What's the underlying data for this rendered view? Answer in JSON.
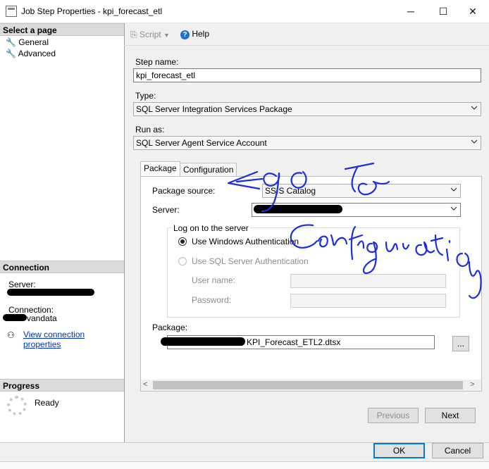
{
  "window": {
    "title": "Job Step Properties - kpi_forecast_etl",
    "controls": [
      "─",
      "☐",
      "✕"
    ]
  },
  "sidebar": {
    "select_page_header": "Select a page",
    "pages": [
      {
        "label": "General"
      },
      {
        "label": "Advanced"
      }
    ],
    "connection_header": "Connection",
    "server_label": "Server:",
    "connection_label": "Connection:",
    "connection_value_visible": "vandata",
    "view_connection_link": "View connection properties",
    "progress_header": "Progress",
    "progress_status": "Ready"
  },
  "toolbar": {
    "script_label": "Script",
    "help_label": "Help"
  },
  "form": {
    "step_name_label": "Step name:",
    "step_name_value": "kpi_forecast_etl",
    "type_label": "Type:",
    "type_value": "SQL Server Integration Services Package",
    "run_as_label": "Run as:",
    "run_as_value": "SQL Server Agent Service Account"
  },
  "tabs": [
    {
      "label": "Package",
      "active": true
    },
    {
      "label": "Configuration",
      "active": false
    }
  ],
  "package_tab": {
    "package_source_label": "Package source:",
    "package_source_value": "SSIS Catalog",
    "server_label": "Server:",
    "logon_group_label": "Log on to the server",
    "windows_auth_label": "Use Windows Authentication",
    "sql_auth_label": "Use SQL Server Authentication",
    "user_name_label": "User name:",
    "password_label": "Password:",
    "package_label": "Package:",
    "package_value_visible": "KPI_Forecast_ETL2.dtsx",
    "browse_label": "..."
  },
  "nav_buttons": {
    "previous": "Previous",
    "next": "Next"
  },
  "footer": {
    "ok": "OK",
    "cancel": "Cancel"
  },
  "annotation": {
    "handwriting": "go to configuration",
    "color": "#1a2ee0"
  },
  "colors": {
    "link": "#0033cc",
    "ok_border": "#0078d7"
  }
}
